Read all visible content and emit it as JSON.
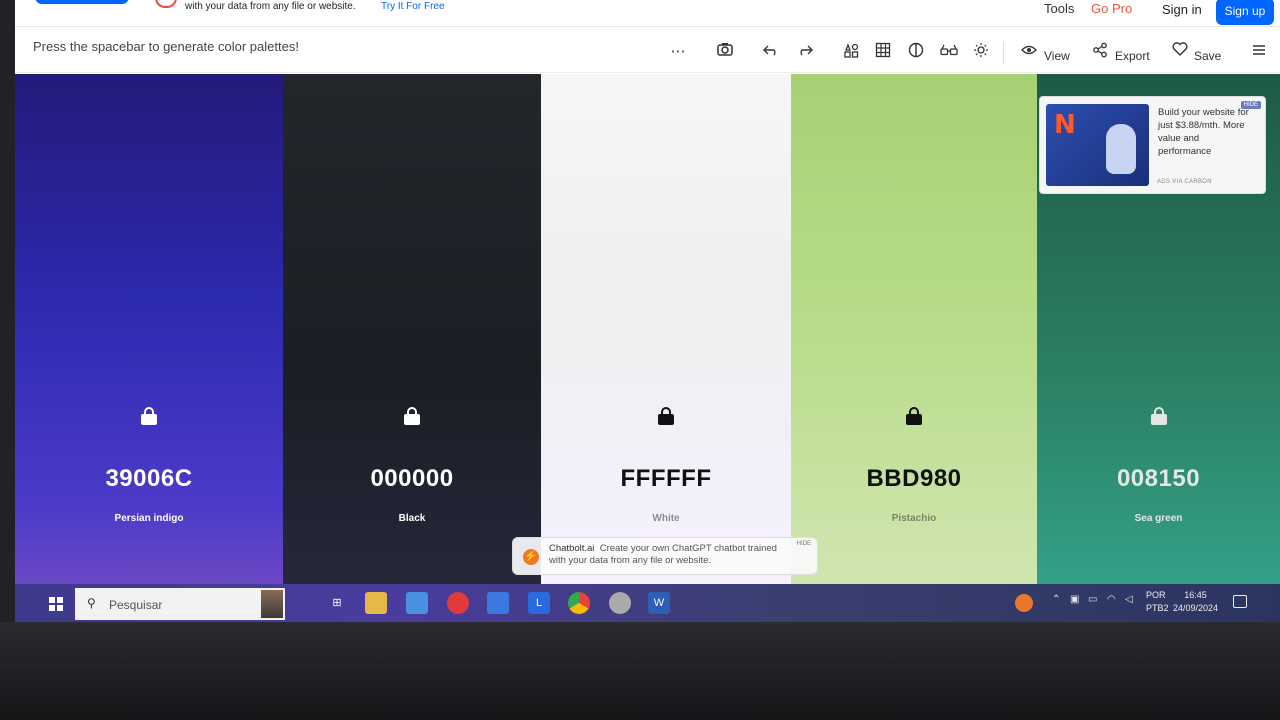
{
  "topbar": {
    "promo_text": "with your data from any file or website.",
    "promo_link": "Try It For Free",
    "nav": {
      "tools": "Tools",
      "go_pro": "Go Pro",
      "sign_in": "Sign in",
      "sign_up": "Sign up"
    }
  },
  "toolbar": {
    "hint": "Press the spacebar to generate color palettes!",
    "more_icon": "⋯",
    "view_label": "View",
    "export_label": "Export",
    "save_label": "Save"
  },
  "palette": [
    {
      "hex": "39006C",
      "name": "Persian indigo",
      "lock_color": "#ffffff",
      "text_color": "#ffffff"
    },
    {
      "hex": "000000",
      "name": "Black",
      "lock_color": "#ffffff",
      "text_color": "#ffffff"
    },
    {
      "hex": "FFFFFF",
      "name": "White",
      "lock_color": "#111111",
      "text_color": "#111111"
    },
    {
      "hex": "BBD980",
      "name": "Pistachio",
      "lock_color": "#111111",
      "text_color": "#111111"
    },
    {
      "hex": "008150",
      "name": "Sea green",
      "lock_color": "#e6e6e6",
      "text_color": "#e6e6e6"
    }
  ],
  "ad": {
    "text": "Build your website for just $3.88/mth. More value and performance",
    "via": "ADS VIA CARBON",
    "hide": "HIDE"
  },
  "chatbolt": {
    "brand": "Chatbolt.ai",
    "text": "Create your own ChatGPT chatbot trained with your data from any file or website.",
    "hide": "HIDE"
  },
  "taskbar": {
    "search_placeholder": "Pesquisar",
    "lang": "POR",
    "layout": "PTB2",
    "time": "16:45",
    "date": "24/09/2024"
  }
}
